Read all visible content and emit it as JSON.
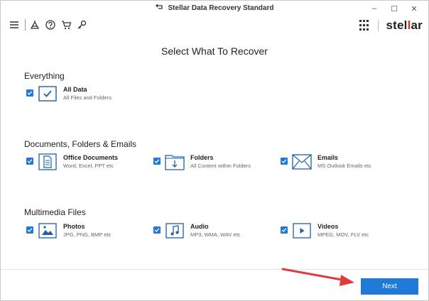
{
  "window": {
    "title": "Stellar Data Recovery Standard",
    "controls": {
      "minimize": "–",
      "maximize": "☐",
      "close": "✕"
    }
  },
  "toolbar": {
    "icons": [
      "menu-icon",
      "scan-icon",
      "help-icon",
      "cart-icon",
      "key-icon"
    ],
    "brand_prefix": "stel",
    "brand_accent": "l",
    "brand_suffix": "ar"
  },
  "page": {
    "title": "Select What To Recover"
  },
  "sections": {
    "everything": {
      "title": "Everything",
      "items": [
        {
          "label": "All Data",
          "desc": "All Files and Folders",
          "icon": "check-box-icon",
          "checked": true
        }
      ]
    },
    "documents": {
      "title": "Documents, Folders & Emails",
      "items": [
        {
          "label": "Office Documents",
          "desc": "Word, Excel, PPT etc",
          "icon": "document-icon",
          "checked": true
        },
        {
          "label": "Folders",
          "desc": "All Content within Folders",
          "icon": "folder-icon",
          "checked": true
        },
        {
          "label": "Emails",
          "desc": "MS Outlook Emails etc",
          "icon": "envelope-icon",
          "checked": true
        }
      ]
    },
    "multimedia": {
      "title": "Multimedia Files",
      "items": [
        {
          "label": "Photos",
          "desc": "JPG, PNG, BMP etc",
          "icon": "photo-icon",
          "checked": true
        },
        {
          "label": "Audio",
          "desc": "MP3, WMA, WAV etc",
          "icon": "music-note-icon",
          "checked": true
        },
        {
          "label": "Videos",
          "desc": "MPEG, MOV, FLV etc",
          "icon": "video-play-icon",
          "checked": true
        }
      ]
    }
  },
  "footer": {
    "next_label": "Next"
  },
  "colors": {
    "accent": "#1e7ad6",
    "brand_red": "#d93025",
    "annotation_arrow": "#e03a3a"
  }
}
